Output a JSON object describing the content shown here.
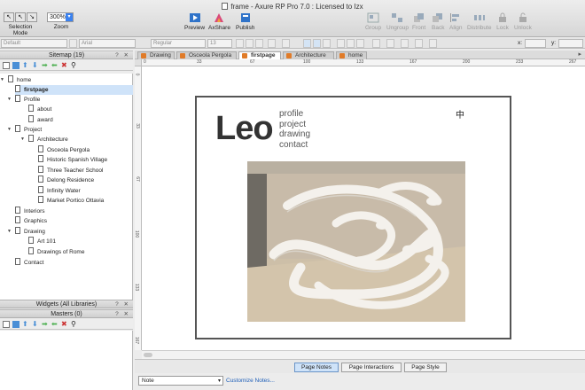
{
  "window": {
    "title": "frame - Axure RP Pro 7.0 : Licensed to Izx"
  },
  "toolbar": {
    "selection_mode_label": "Selection Mode",
    "zoom_value": "300%",
    "zoom_label": "Zoom",
    "preview_label": "Preview",
    "axshare_label": "AxShare",
    "publish_label": "Publish",
    "group_label": "Group",
    "ungroup_label": "Ungroup",
    "front_label": "Front",
    "back_label": "Back",
    "align_label": "Align",
    "distribute_label": "Distribute",
    "lock_label": "Lock",
    "unlock_label": "Unlock"
  },
  "format": {
    "style": "Default",
    "font": "Arial",
    "weight": "Regular",
    "size": "13",
    "x_label": "x:",
    "y_label": "y:"
  },
  "sitemap": {
    "header": "Sitemap (19)",
    "nodes": [
      {
        "label": "home"
      },
      {
        "label": "firstpage"
      },
      {
        "label": "Profile"
      },
      {
        "label": "about"
      },
      {
        "label": "award"
      },
      {
        "label": "Project"
      },
      {
        "label": "Architecture"
      },
      {
        "label": "Osceola Pergola"
      },
      {
        "label": "Historic Spanish Village"
      },
      {
        "label": "Three Teacher School"
      },
      {
        "label": "Delong Residence"
      },
      {
        "label": "Infinity Water"
      },
      {
        "label": "Market Portico Ottavia"
      },
      {
        "label": "Interiors"
      },
      {
        "label": "Graphics"
      },
      {
        "label": "Drawing"
      },
      {
        "label": "Art 101"
      },
      {
        "label": "Drawings of Rome"
      },
      {
        "label": "Contact"
      }
    ]
  },
  "widgets": {
    "header": "Widgets (All Libraries)"
  },
  "masters": {
    "header": "Masters (0)"
  },
  "tabs": [
    {
      "label": "Drawing"
    },
    {
      "label": "Osceola Pergola"
    },
    {
      "label": "firstpage"
    },
    {
      "label": "Architecture"
    },
    {
      "label": "home"
    }
  ],
  "ruler": {
    "h": [
      "0",
      "33",
      "67",
      "100",
      "133",
      "167",
      "200",
      "233",
      "267",
      "300",
      "333",
      "367",
      "400",
      "433",
      "467",
      "500"
    ],
    "v": [
      "0",
      "33",
      "67",
      "100",
      "133",
      "167"
    ]
  },
  "page": {
    "logo": "Leo",
    "menu": [
      "profile",
      "project",
      "drawing",
      "contact"
    ],
    "lang": "中"
  },
  "notes": {
    "tabs": [
      "Page Notes",
      "Page Interactions",
      "Page Style"
    ],
    "select_value": "Note",
    "customize_link": "Customize Notes..."
  },
  "colors": {
    "accent": "#3b82f0",
    "selection": "#cfe3f9",
    "link": "#1f5fb8"
  }
}
